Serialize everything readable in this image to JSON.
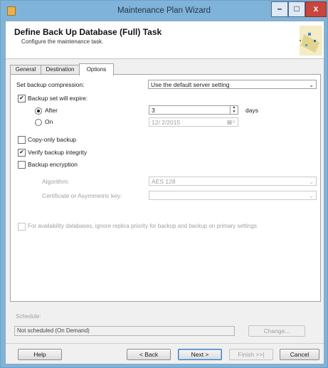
{
  "window": {
    "title": "Maintenance Plan Wizard",
    "minimize_glyph": "–",
    "maximize_glyph": "□",
    "close_glyph": "x"
  },
  "header": {
    "title": "Define Back Up Database (Full) Task",
    "subtitle": "Configure the maintenance task."
  },
  "tabs": [
    {
      "label": "General",
      "selected": false
    },
    {
      "label": "Destination",
      "selected": false
    },
    {
      "label": "Options",
      "selected": true
    }
  ],
  "options": {
    "compression_label": "Set backup compression:",
    "compression_value": "Use the default server setting",
    "expire_label": "Backup set will expire:",
    "expire_checked": true,
    "after_label": "After",
    "after_selected": true,
    "after_value": "3",
    "days_label": "days",
    "on_label": "On",
    "on_selected": false,
    "on_value": "12/ 2/2015",
    "copy_only_label": "Copy-only backup",
    "copy_only_checked": false,
    "verify_label": "Verify backup integrity",
    "verify_checked": true,
    "encryption_label": "Backup encryption",
    "encryption_checked": false,
    "algorithm_label": "Algorithm:",
    "algorithm_value": "AES 128",
    "certificate_label": "Certificate or Asymmetric key:",
    "certificate_value": "",
    "availability_label": "For availability databases, ignore replica priority for backup and backup on primary settings",
    "availability_checked": false
  },
  "schedule": {
    "label": "Schedule:",
    "value": "Not scheduled (On Demand)",
    "change_button": "Change..."
  },
  "buttons": {
    "help": "Help",
    "back": "< Back",
    "next": "Next >",
    "finish": "Finish >>|",
    "cancel": "Cancel"
  },
  "colors": {
    "titlebar": "#7fb3d9",
    "close_button": "#c9463d",
    "dialog_background": "#f0f0f0"
  }
}
